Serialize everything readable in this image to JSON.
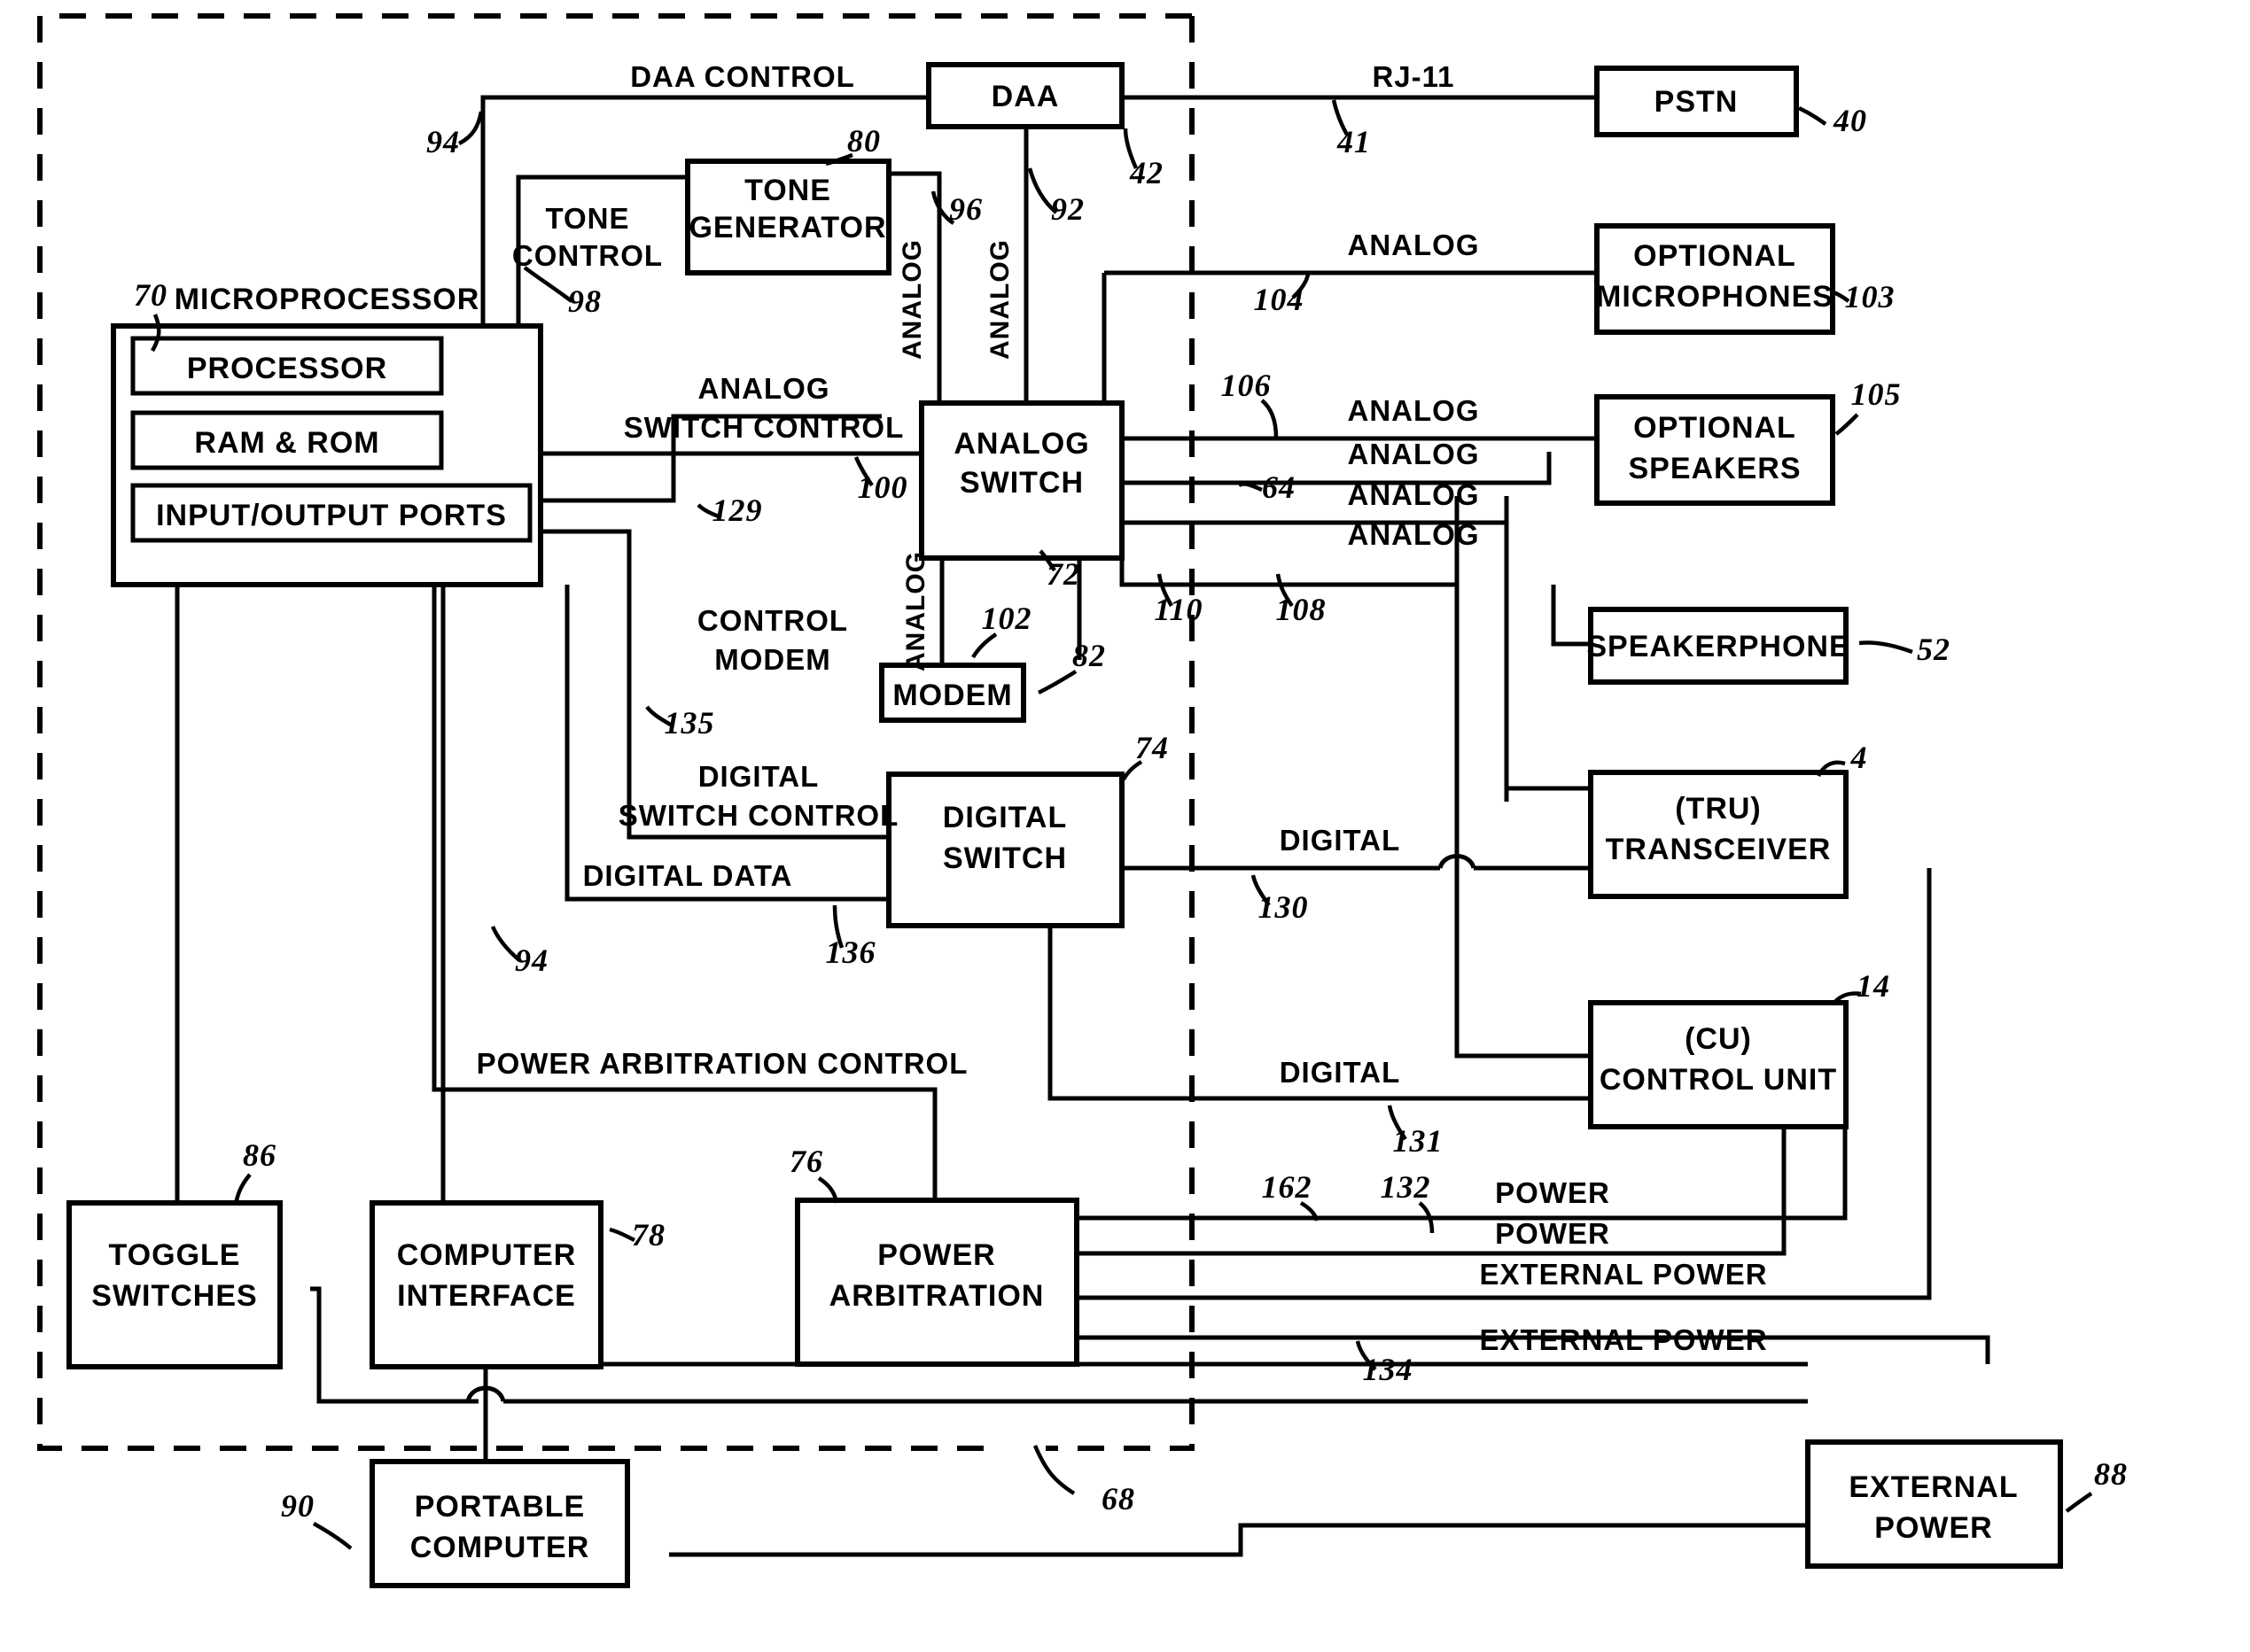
{
  "figure": {
    "type": "patent-block-diagram",
    "boundary_label": "68"
  },
  "blocks": [
    {
      "id": "microprocessor",
      "label": "MICROPROCESSOR",
      "ref": "70",
      "sub": [
        "PROCESSOR",
        "RAM & ROM",
        "INPUT/OUTPUT PORTS"
      ]
    },
    {
      "id": "tone-generator",
      "label_line1": "TONE",
      "label_line2": "GENERATOR",
      "ref": "80"
    },
    {
      "id": "daa",
      "label": "DAA",
      "ref": "42"
    },
    {
      "id": "pstn",
      "label": "PSTN",
      "ref": "40"
    },
    {
      "id": "optional-microphones",
      "label_line1": "OPTIONAL",
      "label_line2": "MICROPHONES",
      "ref": "103"
    },
    {
      "id": "optional-speakers",
      "label_line1": "OPTIONAL",
      "label_line2": "SPEAKERS",
      "ref": "105"
    },
    {
      "id": "analog-switch",
      "label_line1": "ANALOG",
      "label_line2": "SWITCH",
      "ref": "72"
    },
    {
      "id": "speakerphone",
      "label": "SPEAKERPHONE",
      "ref": "52"
    },
    {
      "id": "modem",
      "label": "MODEM",
      "ref": "82"
    },
    {
      "id": "digital-switch",
      "label_line1": "DIGITAL",
      "label_line2": "SWITCH",
      "ref": "74"
    },
    {
      "id": "tru-transceiver",
      "label_line1": "(TRU)",
      "label_line2": "TRANSCEIVER",
      "ref": "4"
    },
    {
      "id": "cu-control-unit",
      "label_line1": "(CU)",
      "label_line2": "CONTROL UNIT",
      "ref": "14"
    },
    {
      "id": "toggle-switches",
      "label_line1": "TOGGLE",
      "label_line2": "SWITCHES",
      "ref": "86"
    },
    {
      "id": "computer-interface",
      "label_line1": "COMPUTER",
      "label_line2": "INTERFACE",
      "ref": "78"
    },
    {
      "id": "power-arbitration",
      "label_line1": "POWER",
      "label_line2": "ARBITRATION",
      "ref": "76"
    },
    {
      "id": "external-power",
      "label_line1": "EXTERNAL",
      "label_line2": "POWER",
      "ref": "88"
    },
    {
      "id": "portable-computer",
      "label_line1": "PORTABLE",
      "label_line2": "COMPUTER",
      "ref": "90"
    }
  ],
  "signal_labels": {
    "daa_control": "DAA CONTROL",
    "rj11": "RJ-11",
    "tone_control_l1": "TONE",
    "tone_control_l2": "CONTROL",
    "analog": "ANALOG",
    "analog_switch_control_l1": "ANALOG",
    "analog_switch_control_l2": "SWITCH CONTROL",
    "control_modem_l1": "CONTROL",
    "control_modem_l2": "MODEM",
    "digital_switch_control_l1": "DIGITAL",
    "digital_switch_control_l2": "SWITCH CONTROL",
    "digital_data": "DIGITAL DATA",
    "digital": "DIGITAL",
    "power": "POWER",
    "external_power": "EXTERNAL POWER",
    "power_arbitration_control": "POWER ARBITRATION CONTROL"
  },
  "reference_numerals": {
    "n4": "4",
    "n14": "14",
    "n40": "40",
    "n41": "41",
    "n42": "42",
    "n52": "52",
    "n64": "64",
    "n68": "68",
    "n70": "70",
    "n72": "72",
    "n74": "74",
    "n76": "76",
    "n78": "78",
    "n80": "80",
    "n82": "82",
    "n86": "86",
    "n88": "88",
    "n90": "90",
    "n92": "92",
    "n94a": "94",
    "n94b": "94",
    "n96": "96",
    "n98": "98",
    "n100": "100",
    "n102": "102",
    "n103": "103",
    "n104": "104",
    "n105": "105",
    "n106": "106",
    "n108": "108",
    "n110": "110",
    "n129": "129",
    "n130": "130",
    "n131": "131",
    "n132": "132",
    "n134": "134",
    "n135": "135",
    "n136": "136",
    "n162": "162"
  }
}
